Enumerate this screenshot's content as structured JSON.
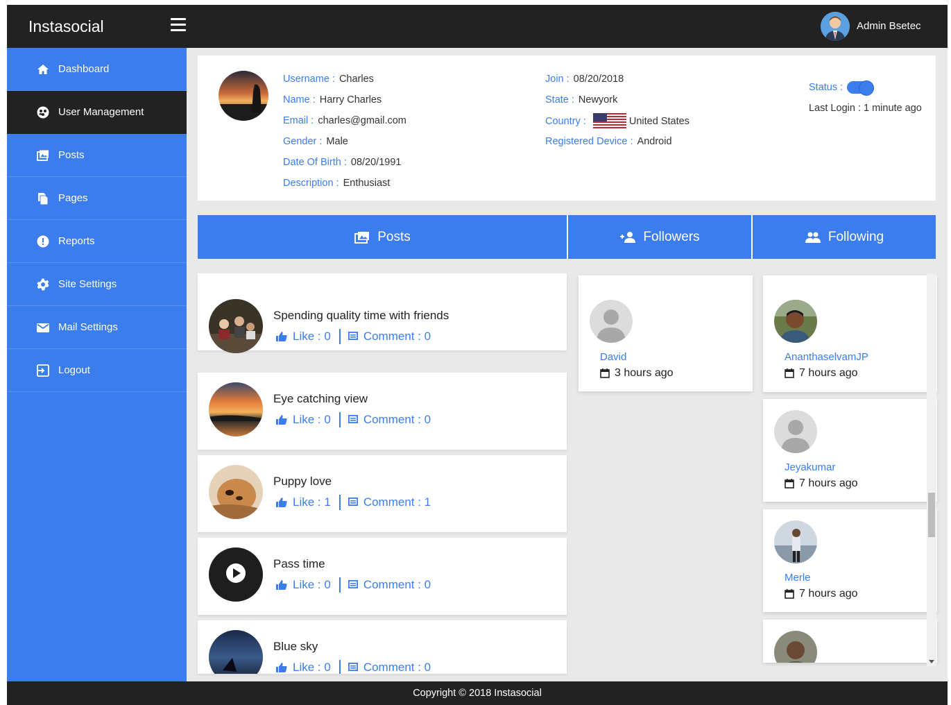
{
  "topbar": {
    "brand": "Instasocial",
    "admin_name": "Admin Bsetec"
  },
  "sidebar": {
    "items": [
      {
        "label": "Dashboard",
        "icon": "home-icon"
      },
      {
        "label": "User Management",
        "icon": "user-management-icon",
        "active": true
      },
      {
        "label": "Posts",
        "icon": "photo-library-icon"
      },
      {
        "label": "Pages",
        "icon": "pages-icon"
      },
      {
        "label": "Reports",
        "icon": "alert-icon"
      },
      {
        "label": "Site Settings",
        "icon": "gear-icon"
      },
      {
        "label": "Mail Settings",
        "icon": "mail-icon"
      },
      {
        "label": "Logout",
        "icon": "logout-icon"
      }
    ]
  },
  "profile": {
    "username_label": "Username :",
    "username": "Charles",
    "name_label": "Name :",
    "name": "Harry Charles",
    "email_label": "Email :",
    "email": "charles@gmail.com",
    "gender_label": "Gender :",
    "gender": "Male",
    "dob_label": "Date Of Birth :",
    "dob": "08/20/1991",
    "description_label": "Description :",
    "description": "Enthusiast",
    "join_label": "Join :",
    "join": "08/20/2018",
    "state_label": "State :",
    "state": "Newyork",
    "country_label": "Country :",
    "country": "United States",
    "device_label": "Registered Device :",
    "device": "Android",
    "status_label": "Status :",
    "status_on": true,
    "last_login": "Last Login : 1 minute ago"
  },
  "tabs": [
    {
      "label": "Posts",
      "icon": "photo-library-icon"
    },
    {
      "label": "Followers",
      "icon": "add-person-icon"
    },
    {
      "label": "Following",
      "icon": "people-icon"
    }
  ],
  "posts": [
    {
      "title": "Spending quality time with friends",
      "like": "Like : 0",
      "comment": "Comment : 0"
    },
    {
      "title": "Eye catching view",
      "like": "Like : 0",
      "comment": "Comment : 0"
    },
    {
      "title": "Puppy love",
      "like": "Like : 1",
      "comment": "Comment : 1"
    },
    {
      "title": "Pass time",
      "like": "Like : 0",
      "comment": "Comment : 0"
    },
    {
      "title": "Blue sky",
      "like": "Like : 0",
      "comment": "Comment : 0"
    }
  ],
  "followers": [
    {
      "name": "David",
      "time": "3 hours ago"
    }
  ],
  "following": [
    {
      "name": "AnanthaselvamJP",
      "time": "7 hours ago"
    },
    {
      "name": "Jeyakumar",
      "time": "7 hours ago"
    },
    {
      "name": "Merle",
      "time": "7 hours ago"
    }
  ],
  "footer": {
    "text": "Copyright © 2018 Instasocial"
  },
  "colors": {
    "primary": "#3b7ded",
    "dark": "#222222",
    "background": "#e9e9e9"
  }
}
